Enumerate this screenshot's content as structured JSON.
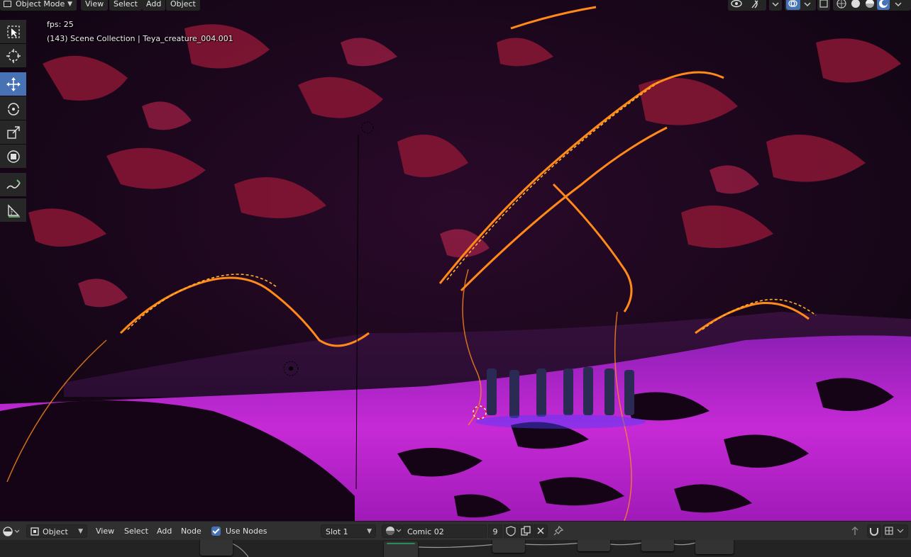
{
  "viewport_header": {
    "mode_label": "Object Mode",
    "menus": [
      "View",
      "Select",
      "Add",
      "Object"
    ]
  },
  "overlay": {
    "fps": "fps: 25",
    "scene_info": "(143) Scene Collection | Teya_creature_004.001"
  },
  "toolbar": {
    "tools": [
      "select-box",
      "cursor",
      "move",
      "rotate",
      "scale",
      "transform",
      "annotate",
      "measure"
    ],
    "active": "move"
  },
  "node_header": {
    "editor_type_icon": "shader-editor-icon",
    "object_dropdown": "Object",
    "menus": [
      "View",
      "Select",
      "Add",
      "Node"
    ],
    "use_nodes_label": "Use Nodes",
    "use_nodes_checked": true,
    "slot_dropdown": "Slot 1",
    "material_name": "Comic 02",
    "user_count": "9"
  },
  "colors": {
    "accent_blue": "#4772b3",
    "header_bg": "#303030",
    "scene_magenta": "#b81fd0",
    "scene_orange": "#ff8a1a"
  }
}
